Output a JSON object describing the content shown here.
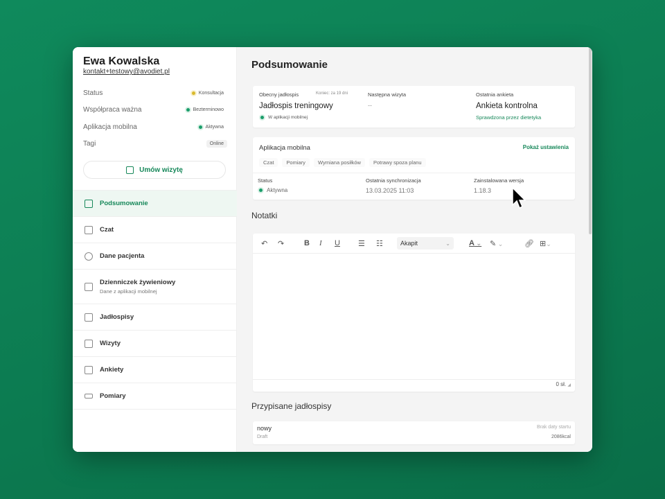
{
  "patient": {
    "name": "Ewa Kowalska",
    "email": "kontakt+testowy@avodiet.pl"
  },
  "info": [
    {
      "label": "Status",
      "value": "Konsultacja",
      "dot": "#d9b92c"
    },
    {
      "label": "Współpraca ważna",
      "value": "Bezterminowo",
      "dot": "#1a9d6a"
    },
    {
      "label": "Aplikacja mobilna",
      "value": "Aktywna",
      "dot": "#1a9d6a"
    },
    {
      "label": "Tagi",
      "value": "Online"
    }
  ],
  "book_button": "Umów wizytę",
  "nav": [
    {
      "label": "Podsumowanie",
      "icon": "dashboard-icon",
      "active": true
    },
    {
      "label": "Czat",
      "icon": "chat-icon"
    },
    {
      "label": "Dane pacjenta",
      "icon": "patient-icon"
    },
    {
      "label": "Dzienniczek żywieniowy",
      "sub": "Dane z aplikacji mobilnej",
      "icon": "book-icon"
    },
    {
      "label": "Jadłospisy",
      "icon": "meal-plan-icon"
    },
    {
      "label": "Wizyty",
      "icon": "calendar-icon"
    },
    {
      "label": "Ankiety",
      "icon": "clipboard-icon"
    },
    {
      "label": "Pomiary",
      "icon": "ruler-icon"
    }
  ],
  "main": {
    "title": "Podsumowanie",
    "summary": {
      "plan_label": "Obecny jadłospis",
      "plan_end": "Koniec: za 19 dni",
      "plan_name": "Jadłospis treningowy",
      "plan_status": "W aplikacji mobilnej",
      "visit_label": "Następna wizyta",
      "visit_value": "--",
      "survey_label": "Ostatnia ankieta",
      "survey_name": "Ankieta kontrolna",
      "survey_status": "Sprawdzona przez dietetyka"
    },
    "app": {
      "title": "Aplikacja mobilna",
      "settings_link": "Pokaż ustawienia",
      "features": [
        "Czat",
        "Pomiary",
        "Wymiana posiłków",
        "Potrawy spoza planu"
      ],
      "status_label": "Status",
      "status_value": "Aktywna",
      "sync_label": "Ostatnia synchronizacja",
      "sync_value": "13.03.2025 11:03",
      "version_label": "Zainstalowana wersja",
      "version_value": "1.18.3"
    },
    "notes": {
      "title": "Notatki",
      "block_format": "Akapit",
      "word_count": "0 sł."
    },
    "plans": {
      "title": "Przypisane jadłospisy",
      "items": [
        {
          "name": "nowy",
          "status": "Draft",
          "start": "Brak daty startu",
          "kcal": "2086kcal"
        }
      ]
    }
  }
}
